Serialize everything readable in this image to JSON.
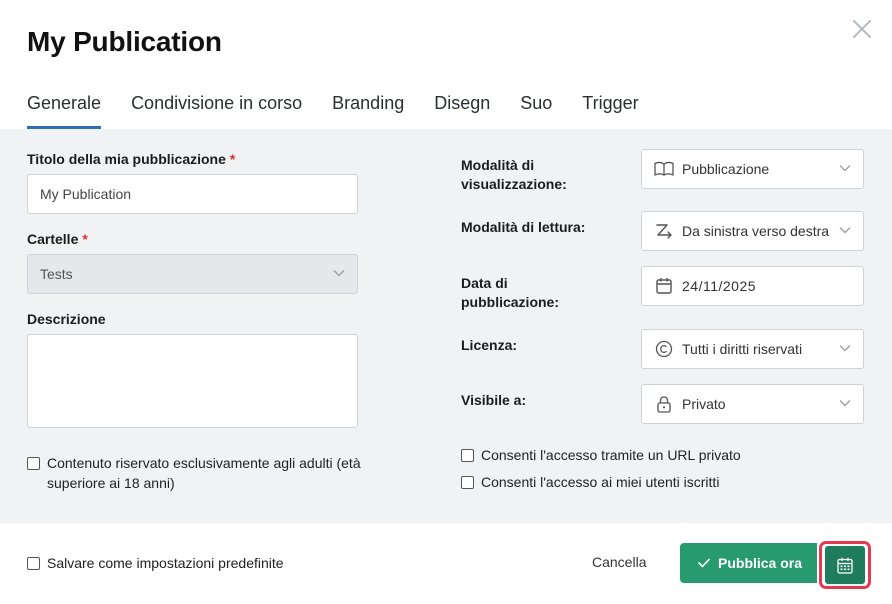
{
  "dialog": {
    "title": "My Publication"
  },
  "tabs": [
    {
      "label": "Generale",
      "active": true
    },
    {
      "label": "Condivisione in corso",
      "active": false
    },
    {
      "label": "Branding",
      "active": false
    },
    {
      "label": "Disegn",
      "active": false
    },
    {
      "label": "Suo",
      "active": false
    },
    {
      "label": "Trigger",
      "active": false
    }
  ],
  "form": {
    "title_label": "Titolo della mia pubblicazione",
    "title_value": "My Publication",
    "folders_label": "Cartelle",
    "folders_value": "Tests",
    "description_label": "Descrizione",
    "description_value": "",
    "adult_label": "Contenuto riservato esclusivamente agli adulti (età superiore ai 18 anni)",
    "required_mark": "*"
  },
  "settings": {
    "view_mode_label": "Modalità di visualizzazione:",
    "view_mode_value": "Pubblicazione",
    "reading_mode_label": "Modalità di lettura:",
    "reading_mode_value": "Da sinistra verso destra",
    "pub_date_label": "Data di pubblicazione:",
    "pub_date_value": "24/11/2025",
    "license_label": "Licenza:",
    "license_value": "Tutti i diritti riservati",
    "visible_label": "Visibile a:",
    "visible_value": "Privato",
    "private_url_label": "Consenti l'accesso tramite un URL privato",
    "subscribers_label": "Consenti l'accesso ai miei utenti iscritti"
  },
  "footer": {
    "save_default_label": "Salvare come impostazioni predefinite",
    "cancel_label": "Cancella",
    "publish_label": "Pubblica ora"
  },
  "colors": {
    "accent_tab": "#2f6fb3",
    "publish_green": "#279a6f",
    "schedule_green": "#1f7d5d",
    "highlight_red": "#e33a52",
    "required_red": "#d9342b"
  },
  "icons": {
    "close": "close-icon",
    "view_mode": "book-open-icon",
    "reading_mode": "reading-direction-icon",
    "date": "calendar-icon",
    "license": "copyright-icon",
    "visibility": "lock-icon",
    "publish": "check-icon",
    "schedule": "calendar-icon"
  }
}
